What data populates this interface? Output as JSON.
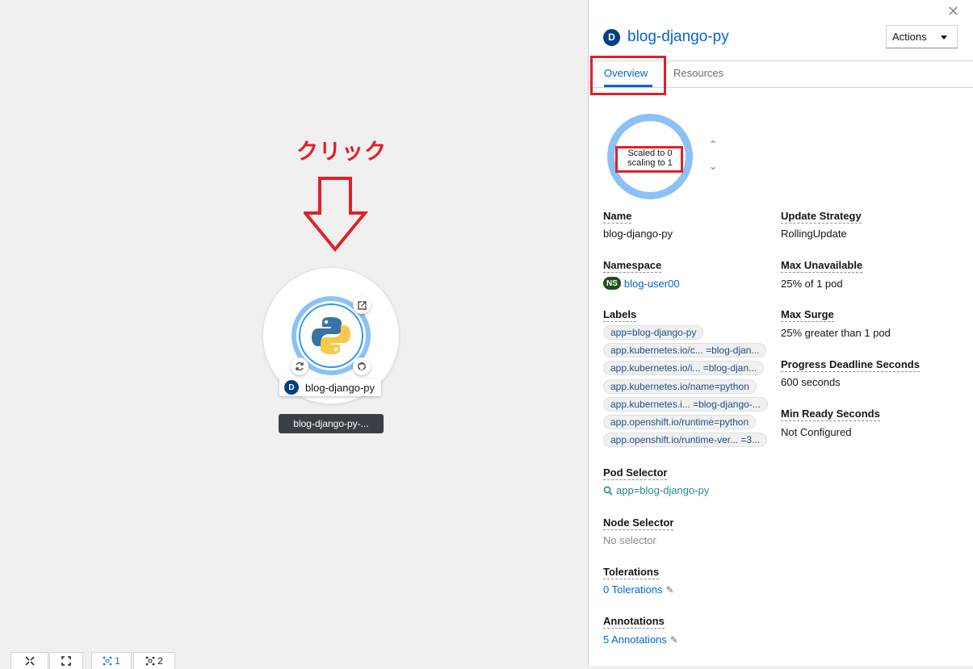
{
  "canvas": {
    "annotation_text": "クリック",
    "node_name": "blog-django-py",
    "node_kind_badge": "D",
    "group_label": "blog-django-py-...",
    "toolbar": {
      "zoom_fit_icon": "expand-icon",
      "fullscreen_icon": "fullscreen-icon",
      "layout1_label": "1",
      "layout2_label": "2"
    }
  },
  "panel": {
    "title": "blog-django-py",
    "kind_badge": "D",
    "actions_label": "Actions",
    "tabs": [
      {
        "label": "Overview",
        "active": true
      },
      {
        "label": "Resources",
        "active": false
      }
    ],
    "pod_ring": {
      "line1": "Scaled to 0",
      "line2": "scaling to 1"
    },
    "left_details": {
      "name_label": "Name",
      "name_value": "blog-django-py",
      "namespace_label": "Namespace",
      "namespace_badge": "NS",
      "namespace_value": "blog-user00",
      "labels_label": "Labels",
      "labels": [
        "app=blog-django-py",
        "app.kubernetes.io/c... =blog-djan...",
        "app.kubernetes.io/i... =blog-djan...",
        "app.kubernetes.io/name=python",
        "app.kubernetes.i... =blog-django-...",
        "app.openshift.io/runtime=python",
        "app.openshift.io/runtime-ver... =3..."
      ],
      "pod_selector_label": "Pod Selector",
      "pod_selector_value": "app=blog-django-py",
      "node_selector_label": "Node Selector",
      "node_selector_value": "No selector",
      "tolerations_label": "Tolerations",
      "tolerations_value": "0 Tolerations",
      "annotations_label": "Annotations",
      "annotations_value": "5 Annotations"
    },
    "right_details": {
      "update_strategy_label": "Update Strategy",
      "update_strategy_value": "RollingUpdate",
      "max_unavailable_label": "Max Unavailable",
      "max_unavailable_value": "25% of 1 pod",
      "max_surge_label": "Max Surge",
      "max_surge_value": "25% greater than 1 pod",
      "progress_deadline_label": "Progress Deadline Seconds",
      "progress_deadline_value": "600 seconds",
      "min_ready_label": "Min Ready Seconds",
      "min_ready_value": "Not Configured"
    }
  },
  "colors": {
    "accent": "#0066cc",
    "annotation_red": "#e0202a",
    "ring": "#8bc1f7"
  }
}
